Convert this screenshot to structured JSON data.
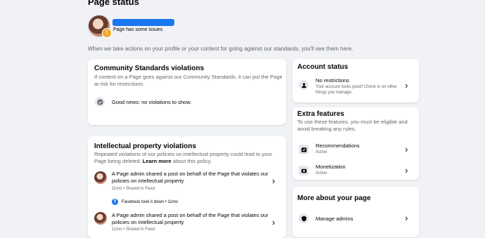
{
  "header": {
    "title": "Page status",
    "issue_text": "Page has some issues",
    "intro": "When we take actions on your profile or your content for going against our standards, you'll see them here.",
    "redacted_color": "#1877f2",
    "badge_color": "#f5a623"
  },
  "community": {
    "title": "Community Standards violations",
    "description": "If content on a Page goes against our Community Standards, it can put the Page at risk for restrictions.",
    "status": "Good news: no violations to show."
  },
  "ip": {
    "title": "Intellectual property violations",
    "description_pre": "Repeated violations of our policies on intellectual property could lead to your Page being deleted.",
    "learn_more": "Learn more",
    "description_post": "about this policy.",
    "items": [
      {
        "text": "A Page admin shared a post on behalf of the Page that violates our policies on intellectual property",
        "meta": "11mo • Shared in Feed"
      },
      {
        "text": "A Page admin shared a post on behalf of the Page that violates our policies on intellectual property",
        "meta": "11mo • Shared in Feed"
      }
    ],
    "takedown": "Facebook took it down • 11mo"
  },
  "account": {
    "title": "Account status",
    "row_title": "No restrictions",
    "row_sub": "Your account looks good! Check in on other things you manage."
  },
  "extra": {
    "title": "Extra features",
    "description": "To use these features, you must be eligible and avoid breaking any rules.",
    "items": [
      {
        "title": "Recommendations",
        "status": "Active"
      },
      {
        "title": "Monetization",
        "status": "Active"
      }
    ]
  },
  "more": {
    "title": "More about your page",
    "manage_admins": "Manage admins"
  },
  "icons": {
    "check": "check-circle-icon",
    "chevron": "chevron-right-icon",
    "lock": "lock-icon",
    "recommend": "recommendation-icon",
    "money": "monetization-icon",
    "shield": "shield-icon",
    "facebook": "facebook-logo-icon",
    "warning": "warning-icon"
  }
}
